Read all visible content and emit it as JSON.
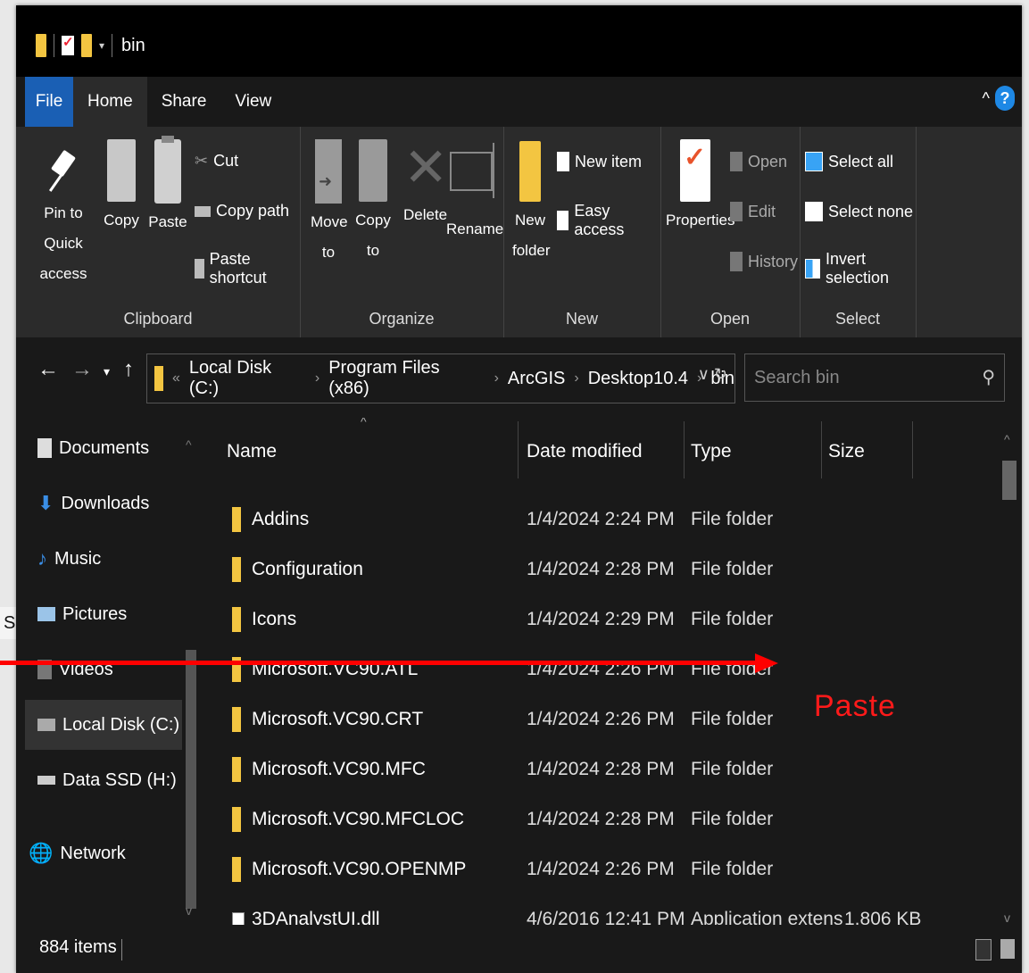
{
  "window": {
    "title": "bin"
  },
  "background_fragment": "SD",
  "tabs": [
    "File",
    "Home",
    "Share",
    "View"
  ],
  "help_label": "?",
  "ribbon": {
    "clipboard": {
      "label": "Clipboard",
      "pin": [
        "Pin to Quick",
        "access"
      ],
      "copy": "Copy",
      "paste": "Paste",
      "cut": "Cut",
      "copy_path": "Copy path",
      "paste_shortcut": "Paste shortcut"
    },
    "organize": {
      "label": "Organize",
      "move_to": [
        "Move",
        "to"
      ],
      "copy_to": [
        "Copy",
        "to"
      ],
      "delete": "Delete",
      "rename": "Rename"
    },
    "new": {
      "label": "New",
      "new_item": "New item",
      "easy_access": "Easy access",
      "new_folder": [
        "New",
        "folder"
      ]
    },
    "open": {
      "label": "Open",
      "properties": "Properties",
      "open": "Open",
      "edit": "Edit",
      "history": "History"
    },
    "select": {
      "label": "Select",
      "select_all": "Select all",
      "select_none": "Select none",
      "invert_selection": "Invert selection"
    }
  },
  "address": {
    "prefix": "«",
    "crumbs": [
      "Local Disk (C:)",
      "Program Files (x86)",
      "ArcGIS",
      "Desktop10.4",
      "bin"
    ],
    "search_placeholder": "Search bin"
  },
  "nav_pane": [
    {
      "label": "Documents",
      "icon": "documents-icon"
    },
    {
      "label": "Downloads",
      "icon": "downloads-icon"
    },
    {
      "label": "Music",
      "icon": "music-icon"
    },
    {
      "label": "Pictures",
      "icon": "pictures-icon"
    },
    {
      "label": "Videos",
      "icon": "videos-icon"
    },
    {
      "label": "Local Disk (C:)",
      "icon": "local-disk-icon",
      "selected": true
    },
    {
      "label": "Data SSD (H:)",
      "icon": "drive-icon"
    },
    {
      "label": "Network",
      "icon": "network-icon"
    }
  ],
  "columns": [
    "Name",
    "Date modified",
    "Type",
    "Size"
  ],
  "files": [
    {
      "name": "Addins",
      "date": "1/4/2024 2:24 PM",
      "type": "File folder",
      "size": ""
    },
    {
      "name": "Configuration",
      "date": "1/4/2024 2:28 PM",
      "type": "File folder",
      "size": ""
    },
    {
      "name": "Icons",
      "date": "1/4/2024 2:29 PM",
      "type": "File folder",
      "size": ""
    },
    {
      "name": "Microsoft.VC90.ATL",
      "date": "1/4/2024 2:26 PM",
      "type": "File folder",
      "size": ""
    },
    {
      "name": "Microsoft.VC90.CRT",
      "date": "1/4/2024 2:26 PM",
      "type": "File folder",
      "size": ""
    },
    {
      "name": "Microsoft.VC90.MFC",
      "date": "1/4/2024 2:28 PM",
      "type": "File folder",
      "size": ""
    },
    {
      "name": "Microsoft.VC90.MFCLOC",
      "date": "1/4/2024 2:28 PM",
      "type": "File folder",
      "size": ""
    },
    {
      "name": "Microsoft.VC90.OPENMP",
      "date": "1/4/2024 2:26 PM",
      "type": "File folder",
      "size": ""
    },
    {
      "name": "3DAnalystUI.dll",
      "date": "4/6/2016 12:41 PM",
      "type": "Application extens",
      "size": "1,806 KB"
    }
  ],
  "status": {
    "count": "884 items"
  },
  "annotation": {
    "text": "Paste",
    "color": "#ff0000"
  },
  "colors": {
    "accent": "#1a5fb4",
    "folder": "#f3c541",
    "background": "#191919"
  }
}
